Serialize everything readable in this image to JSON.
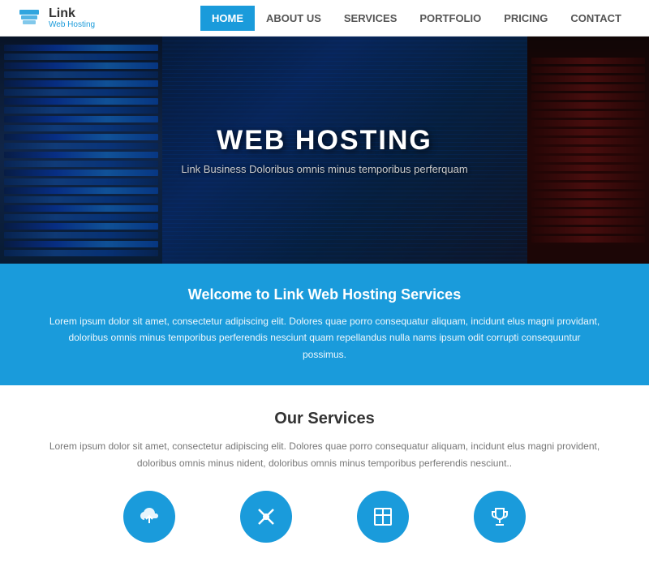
{
  "header": {
    "logo_link": "Link",
    "logo_sub": "Web Hosting",
    "nav": [
      {
        "label": "HOME",
        "active": true
      },
      {
        "label": "ABOUT US",
        "active": false
      },
      {
        "label": "SERVICES",
        "active": false
      },
      {
        "label": "PORTFOLIO",
        "active": false
      },
      {
        "label": "PRICING",
        "active": false
      },
      {
        "label": "CONTACT",
        "active": false
      }
    ]
  },
  "hero": {
    "title": "WEB HOSTING",
    "subtitle": "Link Business Doloribus omnis minus temporibus perferquam"
  },
  "blue_section": {
    "heading": "Welcome to Link Web Hosting Services",
    "body": "Lorem ipsum dolor sit amet, consectetur adipiscing elit. Dolores quae porro consequatur aliquam, incidunt elus magni providant, doloribus omnis minus temporibus perferendis nesciunt quam repellandus nulla nams ipsum odit corrupti consequuntur possimus."
  },
  "services_section": {
    "heading": "Our Services",
    "body": "Lorem ipsum dolor sit amet, consectetur adipiscing elit. Dolores quae porro consequatur aliquam, incidunt elus magni provident, doloribus omnis minus nident, doloribus omnis minus temporibus perferendis nesciunt..",
    "icons": [
      {
        "name": "cloud-upload-icon",
        "symbol": "☁"
      },
      {
        "name": "tools-icon",
        "symbol": "✄"
      },
      {
        "name": "table-icon",
        "symbol": "▦"
      },
      {
        "name": "trophy-icon",
        "symbol": "🏆"
      }
    ]
  }
}
